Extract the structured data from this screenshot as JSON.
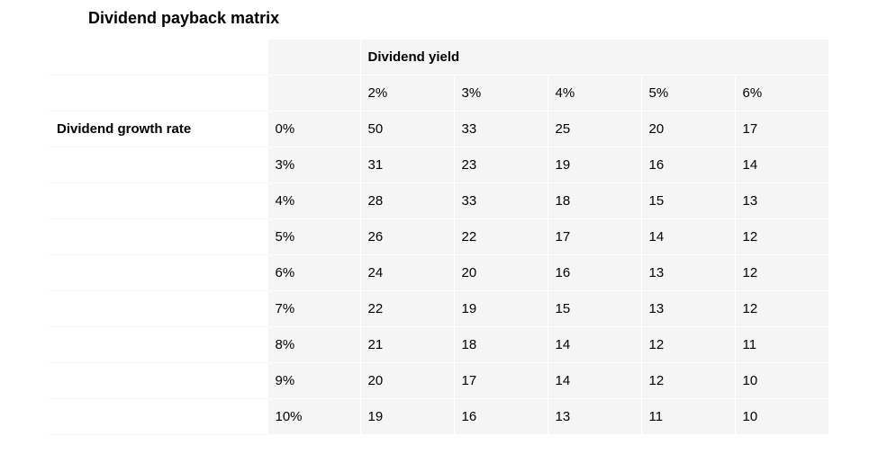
{
  "title": "Dividend payback matrix",
  "col_header": "Dividend yield",
  "row_header": "Dividend growth rate",
  "yields": [
    "2%",
    "3%",
    "4%",
    "5%",
    "6%"
  ],
  "growth_rates": [
    "0%",
    "3%",
    "4%",
    "5%",
    "6%",
    "7%",
    "8%",
    "9%",
    "10%"
  ],
  "rows": [
    [
      "50",
      "33",
      "25",
      "20",
      "17"
    ],
    [
      "31",
      "23",
      "19",
      "16",
      "14"
    ],
    [
      "28",
      "33",
      "18",
      "15",
      "13"
    ],
    [
      "26",
      "22",
      "17",
      "14",
      "12"
    ],
    [
      "24",
      "20",
      "16",
      "13",
      "12"
    ],
    [
      "22",
      "19",
      "15",
      "13",
      "12"
    ],
    [
      "21",
      "18",
      "14",
      "12",
      "11"
    ],
    [
      "20",
      "17",
      "14",
      "12",
      "10"
    ],
    [
      "19",
      "16",
      "13",
      "11",
      "10"
    ]
  ],
  "chart_data": {
    "type": "table",
    "title": "Dividend payback matrix",
    "xlabel": "Dividend yield",
    "ylabel": "Dividend growth rate",
    "x": [
      "2%",
      "3%",
      "4%",
      "5%",
      "6%"
    ],
    "y": [
      "0%",
      "3%",
      "4%",
      "5%",
      "6%",
      "7%",
      "8%",
      "9%",
      "10%"
    ],
    "values": [
      [
        50,
        33,
        25,
        20,
        17
      ],
      [
        31,
        23,
        19,
        16,
        14
      ],
      [
        28,
        33,
        18,
        15,
        13
      ],
      [
        26,
        22,
        17,
        14,
        12
      ],
      [
        24,
        20,
        16,
        13,
        12
      ],
      [
        22,
        19,
        15,
        13,
        12
      ],
      [
        21,
        18,
        14,
        12,
        11
      ],
      [
        20,
        17,
        14,
        12,
        10
      ],
      [
        19,
        16,
        13,
        11,
        10
      ]
    ]
  }
}
